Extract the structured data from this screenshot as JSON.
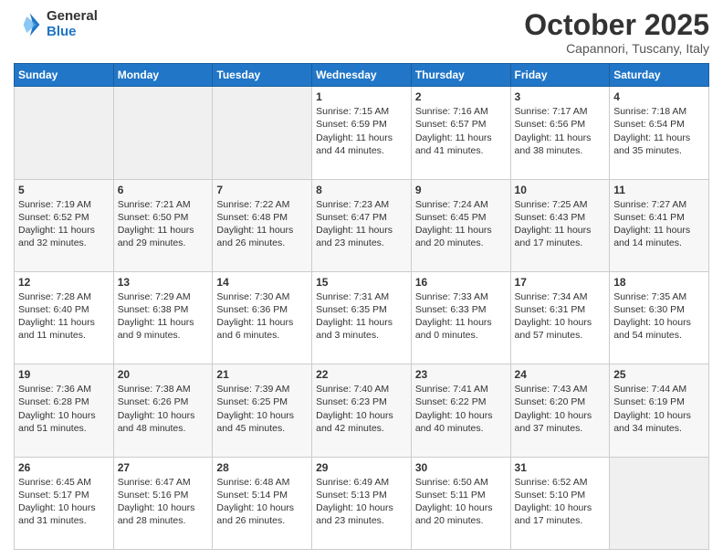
{
  "logo": {
    "general": "General",
    "blue": "Blue"
  },
  "header": {
    "month": "October 2025",
    "location": "Capannori, Tuscany, Italy"
  },
  "days_of_week": [
    "Sunday",
    "Monday",
    "Tuesday",
    "Wednesday",
    "Thursday",
    "Friday",
    "Saturday"
  ],
  "weeks": [
    [
      {
        "day": "",
        "info": ""
      },
      {
        "day": "",
        "info": ""
      },
      {
        "day": "",
        "info": ""
      },
      {
        "day": "1",
        "info": "Sunrise: 7:15 AM\nSunset: 6:59 PM\nDaylight: 11 hours and 44 minutes."
      },
      {
        "day": "2",
        "info": "Sunrise: 7:16 AM\nSunset: 6:57 PM\nDaylight: 11 hours and 41 minutes."
      },
      {
        "day": "3",
        "info": "Sunrise: 7:17 AM\nSunset: 6:56 PM\nDaylight: 11 hours and 38 minutes."
      },
      {
        "day": "4",
        "info": "Sunrise: 7:18 AM\nSunset: 6:54 PM\nDaylight: 11 hours and 35 minutes."
      }
    ],
    [
      {
        "day": "5",
        "info": "Sunrise: 7:19 AM\nSunset: 6:52 PM\nDaylight: 11 hours and 32 minutes."
      },
      {
        "day": "6",
        "info": "Sunrise: 7:21 AM\nSunset: 6:50 PM\nDaylight: 11 hours and 29 minutes."
      },
      {
        "day": "7",
        "info": "Sunrise: 7:22 AM\nSunset: 6:48 PM\nDaylight: 11 hours and 26 minutes."
      },
      {
        "day": "8",
        "info": "Sunrise: 7:23 AM\nSunset: 6:47 PM\nDaylight: 11 hours and 23 minutes."
      },
      {
        "day": "9",
        "info": "Sunrise: 7:24 AM\nSunset: 6:45 PM\nDaylight: 11 hours and 20 minutes."
      },
      {
        "day": "10",
        "info": "Sunrise: 7:25 AM\nSunset: 6:43 PM\nDaylight: 11 hours and 17 minutes."
      },
      {
        "day": "11",
        "info": "Sunrise: 7:27 AM\nSunset: 6:41 PM\nDaylight: 11 hours and 14 minutes."
      }
    ],
    [
      {
        "day": "12",
        "info": "Sunrise: 7:28 AM\nSunset: 6:40 PM\nDaylight: 11 hours and 11 minutes."
      },
      {
        "day": "13",
        "info": "Sunrise: 7:29 AM\nSunset: 6:38 PM\nDaylight: 11 hours and 9 minutes."
      },
      {
        "day": "14",
        "info": "Sunrise: 7:30 AM\nSunset: 6:36 PM\nDaylight: 11 hours and 6 minutes."
      },
      {
        "day": "15",
        "info": "Sunrise: 7:31 AM\nSunset: 6:35 PM\nDaylight: 11 hours and 3 minutes."
      },
      {
        "day": "16",
        "info": "Sunrise: 7:33 AM\nSunset: 6:33 PM\nDaylight: 11 hours and 0 minutes."
      },
      {
        "day": "17",
        "info": "Sunrise: 7:34 AM\nSunset: 6:31 PM\nDaylight: 10 hours and 57 minutes."
      },
      {
        "day": "18",
        "info": "Sunrise: 7:35 AM\nSunset: 6:30 PM\nDaylight: 10 hours and 54 minutes."
      }
    ],
    [
      {
        "day": "19",
        "info": "Sunrise: 7:36 AM\nSunset: 6:28 PM\nDaylight: 10 hours and 51 minutes."
      },
      {
        "day": "20",
        "info": "Sunrise: 7:38 AM\nSunset: 6:26 PM\nDaylight: 10 hours and 48 minutes."
      },
      {
        "day": "21",
        "info": "Sunrise: 7:39 AM\nSunset: 6:25 PM\nDaylight: 10 hours and 45 minutes."
      },
      {
        "day": "22",
        "info": "Sunrise: 7:40 AM\nSunset: 6:23 PM\nDaylight: 10 hours and 42 minutes."
      },
      {
        "day": "23",
        "info": "Sunrise: 7:41 AM\nSunset: 6:22 PM\nDaylight: 10 hours and 40 minutes."
      },
      {
        "day": "24",
        "info": "Sunrise: 7:43 AM\nSunset: 6:20 PM\nDaylight: 10 hours and 37 minutes."
      },
      {
        "day": "25",
        "info": "Sunrise: 7:44 AM\nSunset: 6:19 PM\nDaylight: 10 hours and 34 minutes."
      }
    ],
    [
      {
        "day": "26",
        "info": "Sunrise: 6:45 AM\nSunset: 5:17 PM\nDaylight: 10 hours and 31 minutes."
      },
      {
        "day": "27",
        "info": "Sunrise: 6:47 AM\nSunset: 5:16 PM\nDaylight: 10 hours and 28 minutes."
      },
      {
        "day": "28",
        "info": "Sunrise: 6:48 AM\nSunset: 5:14 PM\nDaylight: 10 hours and 26 minutes."
      },
      {
        "day": "29",
        "info": "Sunrise: 6:49 AM\nSunset: 5:13 PM\nDaylight: 10 hours and 23 minutes."
      },
      {
        "day": "30",
        "info": "Sunrise: 6:50 AM\nSunset: 5:11 PM\nDaylight: 10 hours and 20 minutes."
      },
      {
        "day": "31",
        "info": "Sunrise: 6:52 AM\nSunset: 5:10 PM\nDaylight: 10 hours and 17 minutes."
      },
      {
        "day": "",
        "info": ""
      }
    ]
  ]
}
